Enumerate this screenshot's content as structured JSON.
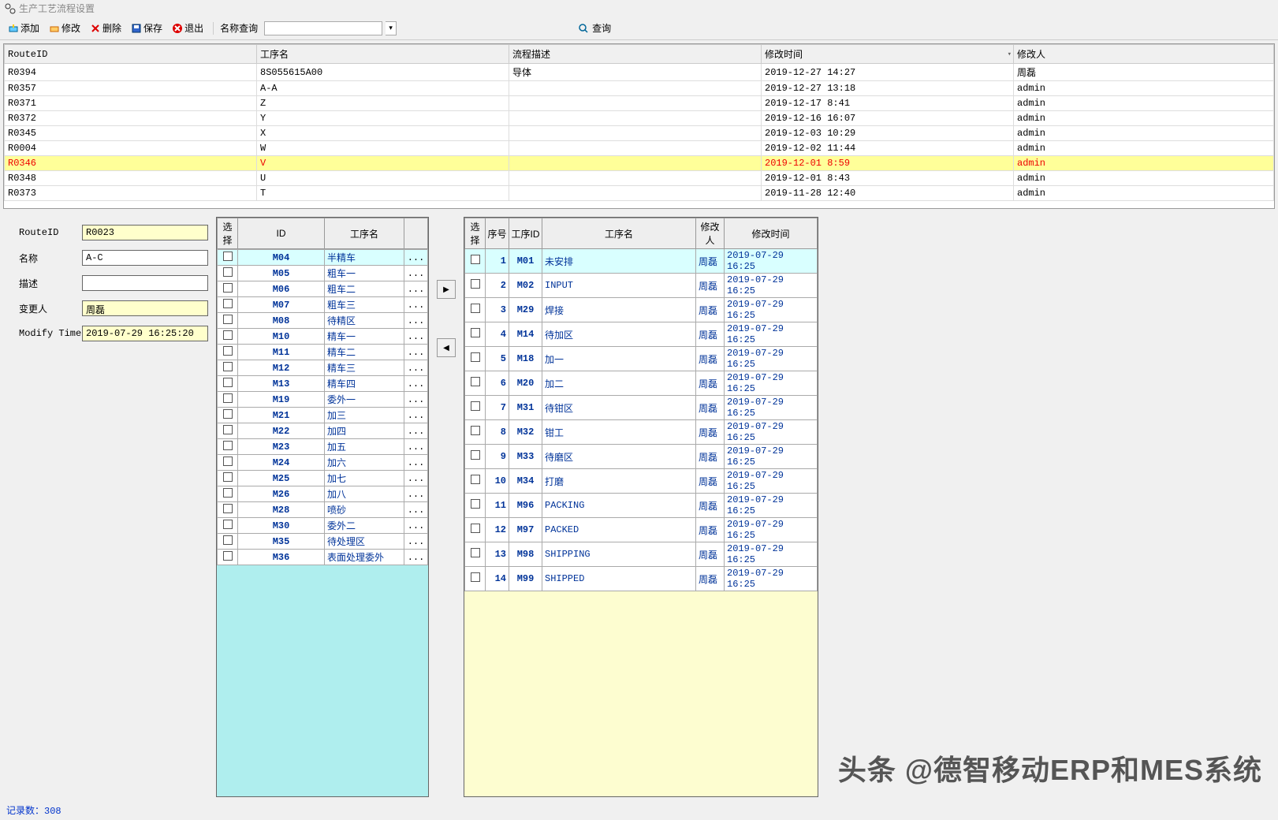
{
  "title": "生产工艺流程设置",
  "toolbar": {
    "add": "添加",
    "edit": "修改",
    "delete": "删除",
    "save": "保存",
    "exit": "退出",
    "nameSearch": "名称查询",
    "query": "查询"
  },
  "topGrid": {
    "cols": [
      "RouteID",
      "工序名",
      "流程描述",
      "修改时间",
      "修改人"
    ],
    "rows": [
      {
        "id": "R0394",
        "name": "8S055615A00",
        "desc": "导体",
        "time": "2019-12-27 14:27",
        "user": "周磊"
      },
      {
        "id": "R0357",
        "name": "A-A",
        "desc": "",
        "time": "2019-12-27 13:18",
        "user": "admin"
      },
      {
        "id": "R0371",
        "name": "Z",
        "desc": "",
        "time": "2019-12-17 8:41",
        "user": "admin"
      },
      {
        "id": "R0372",
        "name": "Y",
        "desc": "",
        "time": "2019-12-16 16:07",
        "user": "admin"
      },
      {
        "id": "R0345",
        "name": "X",
        "desc": "",
        "time": "2019-12-03 10:29",
        "user": "admin"
      },
      {
        "id": "R0004",
        "name": "W",
        "desc": "",
        "time": "2019-12-02 11:44",
        "user": "admin"
      },
      {
        "id": "R0346",
        "name": "V",
        "desc": "",
        "time": "2019-12-01 8:59",
        "user": "admin",
        "sel": true
      },
      {
        "id": "R0348",
        "name": "U",
        "desc": "",
        "time": "2019-12-01 8:43",
        "user": "admin"
      },
      {
        "id": "R0373",
        "name": "T",
        "desc": "",
        "time": "2019-11-28 12:40",
        "user": "admin"
      }
    ]
  },
  "form": {
    "routeIdLabel": "RouteID",
    "routeId": "R0023",
    "nameLabel": "名称",
    "name": "A-C",
    "descLabel": "描述",
    "desc": "",
    "userLabel": "变更人",
    "user": "周磊",
    "timeLabel": "Modify Time",
    "time": "2019-07-29 16:25:20"
  },
  "midGrid": {
    "cols": [
      "选择",
      "ID",
      "工序名",
      ""
    ],
    "rows": [
      {
        "id": "M04",
        "name": "半精车",
        "hl": true
      },
      {
        "id": "M05",
        "name": "粗车一"
      },
      {
        "id": "M06",
        "name": "粗车二"
      },
      {
        "id": "M07",
        "name": "粗车三"
      },
      {
        "id": "M08",
        "name": "待精区"
      },
      {
        "id": "M10",
        "name": "精车一"
      },
      {
        "id": "M11",
        "name": "精车二"
      },
      {
        "id": "M12",
        "name": "精车三"
      },
      {
        "id": "M13",
        "name": "精车四"
      },
      {
        "id": "M19",
        "name": "委外一"
      },
      {
        "id": "M21",
        "name": "加三"
      },
      {
        "id": "M22",
        "name": "加四"
      },
      {
        "id": "M23",
        "name": "加五"
      },
      {
        "id": "M24",
        "name": "加六"
      },
      {
        "id": "M25",
        "name": "加七"
      },
      {
        "id": "M26",
        "name": "加八"
      },
      {
        "id": "M28",
        "name": "喷砂"
      },
      {
        "id": "M30",
        "name": "委外二"
      },
      {
        "id": "M35",
        "name": "待处理区"
      },
      {
        "id": "M36",
        "name": "表面处理委外"
      }
    ]
  },
  "rightGrid": {
    "cols": [
      "选择",
      "序号",
      "工序ID",
      "工序名",
      "修改人",
      "修改时间"
    ],
    "rows": [
      {
        "seq": 1,
        "id": "M01",
        "name": "未安排",
        "u": "周磊",
        "t": "2019-07-29 16:25",
        "hl": true
      },
      {
        "seq": 2,
        "id": "M02",
        "name": "INPUT",
        "u": "周磊",
        "t": "2019-07-29 16:25"
      },
      {
        "seq": 3,
        "id": "M29",
        "name": "焊接",
        "u": "周磊",
        "t": "2019-07-29 16:25"
      },
      {
        "seq": 4,
        "id": "M14",
        "name": "待加区",
        "u": "周磊",
        "t": "2019-07-29 16:25"
      },
      {
        "seq": 5,
        "id": "M18",
        "name": "加一",
        "u": "周磊",
        "t": "2019-07-29 16:25"
      },
      {
        "seq": 6,
        "id": "M20",
        "name": "加二",
        "u": "周磊",
        "t": "2019-07-29 16:25"
      },
      {
        "seq": 7,
        "id": "M31",
        "name": "待钳区",
        "u": "周磊",
        "t": "2019-07-29 16:25"
      },
      {
        "seq": 8,
        "id": "M32",
        "name": "钳工",
        "u": "周磊",
        "t": "2019-07-29 16:25"
      },
      {
        "seq": 9,
        "id": "M33",
        "name": "待磨区",
        "u": "周磊",
        "t": "2019-07-29 16:25"
      },
      {
        "seq": 10,
        "id": "M34",
        "name": "打磨",
        "u": "周磊",
        "t": "2019-07-29 16:25"
      },
      {
        "seq": 11,
        "id": "M96",
        "name": "PACKING",
        "u": "周磊",
        "t": "2019-07-29 16:25"
      },
      {
        "seq": 12,
        "id": "M97",
        "name": "PACKED",
        "u": "周磊",
        "t": "2019-07-29 16:25"
      },
      {
        "seq": 13,
        "id": "M98",
        "name": "SHIPPING",
        "u": "周磊",
        "t": "2019-07-29 16:25"
      },
      {
        "seq": 14,
        "id": "M99",
        "name": "SHIPPED",
        "u": "周磊",
        "t": "2019-07-29 16:25"
      }
    ]
  },
  "status": "记录数：308",
  "watermark": "头条 @德智移动ERP和MES系统"
}
